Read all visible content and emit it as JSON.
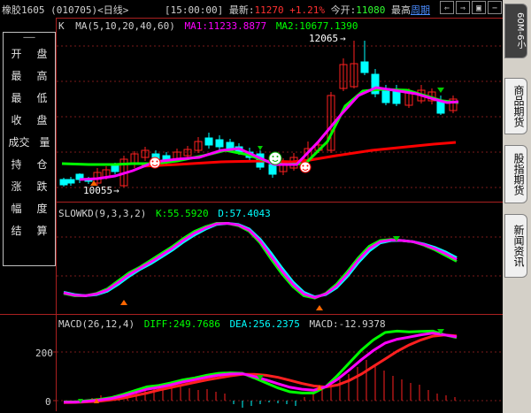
{
  "header": {
    "symbol": "橡胶1605 (010705)<日线>",
    "time": "[15:00:00]",
    "latest_label": "最新:",
    "latest_value": "11270",
    "change": "+1.21%",
    "open_label": "今开:",
    "open_value": "11080",
    "high_label": "最高",
    "period_link": "周期",
    "nav_buttons": [
      "⇐",
      "⇒",
      "▣",
      "−",
      "+"
    ]
  },
  "k_panel": {
    "title_prefix": "K",
    "ma_label": "MA(5,10,20,40,60)",
    "ma1": "MA1:11233.8877",
    "ma2": "MA2:10677.1390",
    "high_mark": "12065",
    "low_mark": "10055"
  },
  "kd_panel": {
    "label": "SLOWKD(9,3,3,2)",
    "k": "K:55.5920",
    "d": "D:57.4043"
  },
  "macd_panel": {
    "label": "MACD(26,12,4)",
    "diff": "DIFF:249.7686",
    "dea": "DEA:256.2375",
    "macd": "MACD:-12.9378",
    "tick_200": "200",
    "tick_0": "0"
  },
  "menu": {
    "items": [
      [
        "开",
        "盘"
      ],
      [
        "最",
        "高"
      ],
      [
        "最",
        "低"
      ],
      [
        "收",
        "盘"
      ],
      [
        "成交",
        "量"
      ],
      [
        "持",
        "仓"
      ],
      [
        "涨",
        "跌"
      ],
      [
        "幅",
        "度"
      ],
      [
        "结",
        "算"
      ]
    ]
  },
  "side_tabs": {
    "period": "60M-6小",
    "tab1": "商品期货",
    "tab2": "股指期货",
    "tab3": "新闻资讯"
  },
  "colors": {
    "up": "#ff2020",
    "down": "#00ffff",
    "ma1": "#ff00ff",
    "ma2": "#00ff00",
    "red_line": "#ff0000",
    "frame": "#aa2020"
  },
  "chart_data": [
    {
      "type": "line",
      "name": "slowkd",
      "series": [
        {
          "name": "K",
          "values": [
            14,
            12,
            12,
            14,
            18,
            25,
            32,
            37,
            43,
            49,
            55,
            62,
            68,
            72,
            75,
            75,
            73,
            68,
            58,
            44,
            31,
            20,
            12,
            10,
            14,
            22,
            33,
            45,
            55,
            60,
            61,
            60,
            59,
            56,
            52,
            47,
            42
          ]
        },
        {
          "name": "D",
          "values": [
            15,
            13,
            12,
            13,
            16,
            22,
            29,
            35,
            40,
            46,
            52,
            59,
            65,
            70,
            74,
            75,
            74,
            70,
            61,
            49,
            36,
            24,
            15,
            11,
            13,
            19,
            29,
            41,
            51,
            58,
            60,
            60,
            59,
            57,
            54,
            50,
            45
          ]
        }
      ]
    },
    {
      "type": "line",
      "name": "macd",
      "ylim": [
        0,
        280
      ],
      "series": [
        {
          "name": "DIFF",
          "values": [
            -5,
            -5,
            0,
            5,
            12,
            25,
            40,
            55,
            60,
            70,
            82,
            90,
            100,
            108,
            110,
            108,
            90,
            70,
            50,
            35,
            30,
            30,
            55,
            100,
            150,
            200,
            240,
            270,
            275,
            272,
            274,
            275,
            260,
            250
          ]
        },
        {
          "name": "DEA",
          "values": [
            -8,
            -7,
            -5,
            -2,
            3,
            10,
            20,
            30,
            42,
            52,
            62,
            72,
            82,
            90,
            98,
            104,
            104,
            100,
            92,
            80,
            68,
            58,
            54,
            62,
            80,
            105,
            135,
            165,
            195,
            220,
            240,
            255,
            260,
            256
          ]
        }
      ]
    }
  ]
}
